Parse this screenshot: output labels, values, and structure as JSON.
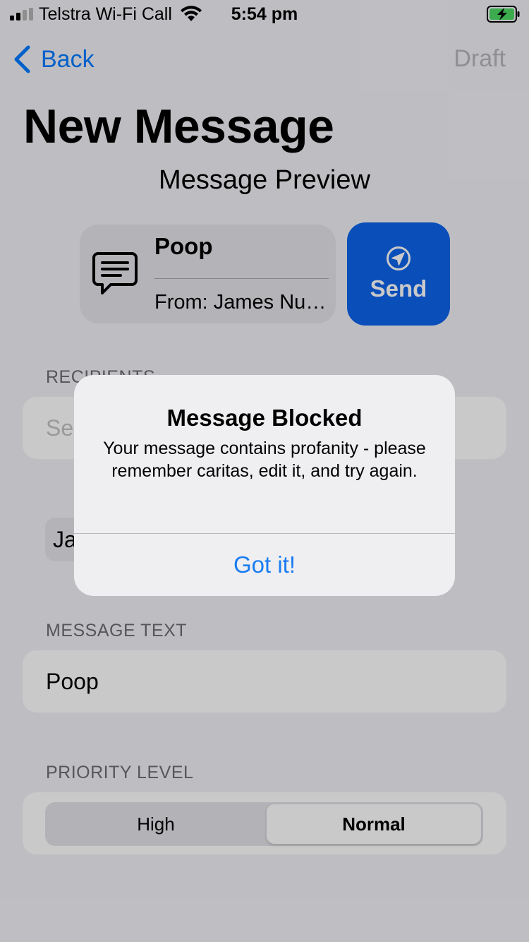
{
  "status_bar": {
    "carrier": "Telstra Wi-Fi Call",
    "time": "5:54 pm",
    "signal_icon": "signal-bars-icon",
    "wifi_icon": "wifi-icon",
    "battery_icon": "battery-charging-icon"
  },
  "nav": {
    "back_label": "Back",
    "draft_label": "Draft"
  },
  "page_title": "New Message",
  "preview": {
    "heading": "Message Preview",
    "subject": "Poop",
    "from": "From: James Nu…",
    "icon": "message-bubble-icon"
  },
  "send_button": {
    "label": "Send",
    "icon": "send-arrow-icon",
    "color": "#0d63eb"
  },
  "recipients": {
    "label": "RECIPIENTS",
    "search_placeholder": "Se",
    "selected_chip": "Ja"
  },
  "message_text": {
    "label": "MESSAGE TEXT",
    "value": "Poop"
  },
  "priority": {
    "label": "PRIORITY LEVEL",
    "options": [
      "High",
      "Normal"
    ],
    "selected": "Normal"
  },
  "alert": {
    "title": "Message Blocked",
    "message": "Your message contains profanity - please remember caritas, edit it, and try again.",
    "button_label": "Got it!",
    "button_color": "#1a7cf2"
  }
}
